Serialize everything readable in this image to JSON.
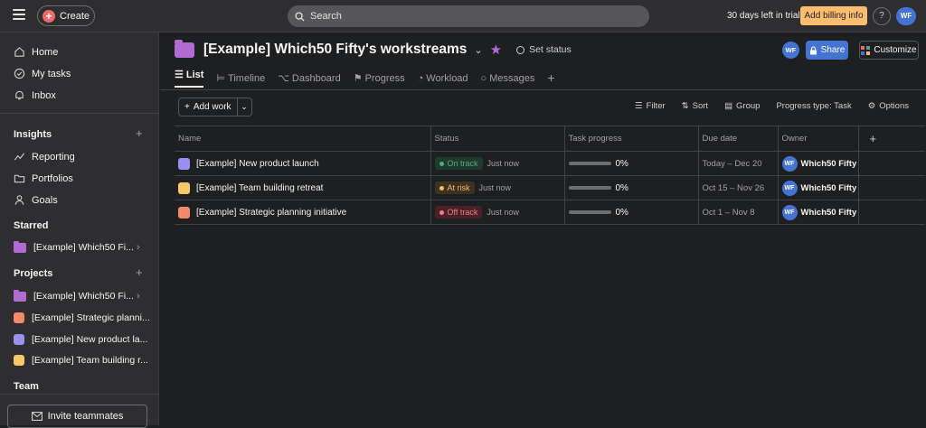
{
  "topbar": {
    "create_label": "Create",
    "search_placeholder": "Search",
    "trial_text": "30 days left in trial",
    "billing_label": "Add billing info",
    "help_label": "?",
    "user_initials": "WF"
  },
  "sidebar": {
    "nav": [
      {
        "label": "Home",
        "icon": "home-icon"
      },
      {
        "label": "My tasks",
        "icon": "check-circle-icon"
      },
      {
        "label": "Inbox",
        "icon": "bell-icon"
      }
    ],
    "insights": {
      "heading": "Insights",
      "items": [
        {
          "label": "Reporting",
          "icon": "line-chart-icon"
        },
        {
          "label": "Portfolios",
          "icon": "folder-icon"
        },
        {
          "label": "Goals",
          "icon": "person-icon"
        }
      ]
    },
    "starred": {
      "heading": "Starred",
      "items": [
        {
          "label": "[Example] Which50 Fi...",
          "color": "#b36bd4"
        }
      ]
    },
    "projects": {
      "heading": "Projects",
      "items": [
        {
          "label": "[Example] Which50 Fi...",
          "color": "#b36bd4",
          "type": "folder"
        },
        {
          "label": "[Example] Strategic planni...",
          "color": "#f2896a",
          "type": "square"
        },
        {
          "label": "[Example] New product la...",
          "color": "#9b8ff0",
          "type": "square"
        },
        {
          "label": "[Example] Team building r...",
          "color": "#f8c76a",
          "type": "square"
        }
      ]
    },
    "team_heading": "Team",
    "invite_label": "Invite teammates"
  },
  "project": {
    "title": "[Example] Which50 Fifty's workstreams",
    "set_status": "Set status",
    "owner_initials": "WF",
    "share_label": "Share",
    "customize_label": "Customize",
    "tabs": [
      "List",
      "Timeline",
      "Dashboard",
      "Progress",
      "Workload",
      "Messages"
    ],
    "active_tab": "List"
  },
  "toolbar": {
    "add_work": "Add work",
    "filter": "Filter",
    "sort": "Sort",
    "group": "Group",
    "progress_type": "Progress type: Task",
    "options": "Options"
  },
  "table": {
    "columns": [
      "Name",
      "Status",
      "Task progress",
      "Due date",
      "Owner"
    ],
    "rows": [
      {
        "name": "[Example] New product launch",
        "icon_color": "#9b8ff0",
        "status": "On track",
        "status_color": "#5da283",
        "status_bg": "#1f3a2e",
        "updated": "Just now",
        "progress": "0%",
        "due": "Today – Dec 20",
        "owner": "Which50 Fifty",
        "owner_initials": "WF"
      },
      {
        "name": "[Example] Team building retreat",
        "icon_color": "#f8c76a",
        "status": "At risk",
        "status_color": "#f1bd6c",
        "status_bg": "#3d3120",
        "updated": "Just now",
        "progress": "0%",
        "due": "Oct 15 – Nov 26",
        "owner": "Which50 Fifty",
        "owner_initials": "WF"
      },
      {
        "name": "[Example] Strategic planning initiative",
        "icon_color": "#f2896a",
        "status": "Off track",
        "status_color": "#e8828a",
        "status_bg": "#4a1f25",
        "updated": "Just now",
        "progress": "0%",
        "due": "Oct 1 – Nov 8",
        "owner": "Which50 Fifty",
        "owner_initials": "WF"
      }
    ]
  }
}
